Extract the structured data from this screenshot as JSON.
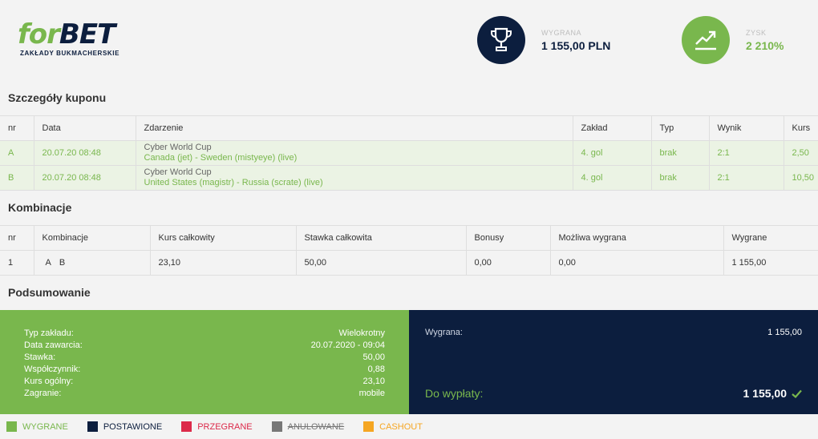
{
  "header": {
    "logo": {
      "main_left": "for",
      "main_right": "BET",
      "subtitle": "ZAKŁADY BUKMACHERSKIE"
    },
    "win": {
      "icon": "trophy-icon",
      "label": "WYGRANA",
      "value": "1 155,00 PLN"
    },
    "profit": {
      "icon": "trend-up-icon",
      "label": "ZYSK",
      "value": "2 210%"
    }
  },
  "coupon": {
    "title": "Szczegóły kuponu",
    "columns": [
      "nr",
      "Data",
      "Zdarzenie",
      "Zakład",
      "Typ",
      "Wynik",
      "Kurs"
    ],
    "rows": [
      {
        "nr": "A",
        "date": "20.07.20 08:48",
        "category": "Cyber World Cup",
        "event": "Canada (jet) - Sweden (mistyeye) (live)",
        "bet": "4. gol",
        "type": "brak",
        "result": "2:1",
        "odds": "2,50"
      },
      {
        "nr": "B",
        "date": "20.07.20 08:48",
        "category": "Cyber World Cup",
        "event": "United States (magistr) - Russia (scrate) (live)",
        "bet": "4. gol",
        "type": "brak",
        "result": "2:1",
        "odds": "10,50"
      }
    ]
  },
  "combinations": {
    "title": "Kombinacje",
    "columns": [
      "nr",
      "Kombinacje",
      "Kurs całkowity",
      "Stawka całkowita",
      "Bonusy",
      "Możliwa wygrana",
      "Wygrane"
    ],
    "rows": [
      {
        "nr": "1",
        "letters": [
          "A",
          "B"
        ],
        "total_odds": "23,10",
        "total_stake": "50,00",
        "bonus": "0,00",
        "possible_win": "0,00",
        "won": "1 155,00"
      }
    ]
  },
  "summary": {
    "title": "Podsumowanie",
    "details": [
      {
        "label": "Typ zakładu:",
        "value": "Wielokrotny"
      },
      {
        "label": "Data zawarcia:",
        "value": "20.07.2020 - 09:04"
      },
      {
        "label": "Stawka:",
        "value": "50,00"
      },
      {
        "label": "Współczynnik:",
        "value": "0,88"
      },
      {
        "label": "Kurs ogólny:",
        "value": "23,10"
      },
      {
        "label": "Zagranie:",
        "value": "mobile"
      }
    ],
    "win_label": "Wygrana:",
    "win_value": "1 155,00",
    "payout_label": "Do wypłaty:",
    "payout_value": "1 155,00"
  },
  "legend": [
    {
      "label": "WYGRANE",
      "color": "#79b74d"
    },
    {
      "label": "POSTAWIONE",
      "color": "#0c1e3e"
    },
    {
      "label": "PRZEGRANE",
      "color": "#dc2a4a"
    },
    {
      "label": "ANULOWANE",
      "color": "#777777"
    },
    {
      "label": "CASHOUT",
      "color": "#f5a623"
    }
  ],
  "colors": {
    "green": "#79b74d",
    "navy": "#0c1e3e"
  }
}
